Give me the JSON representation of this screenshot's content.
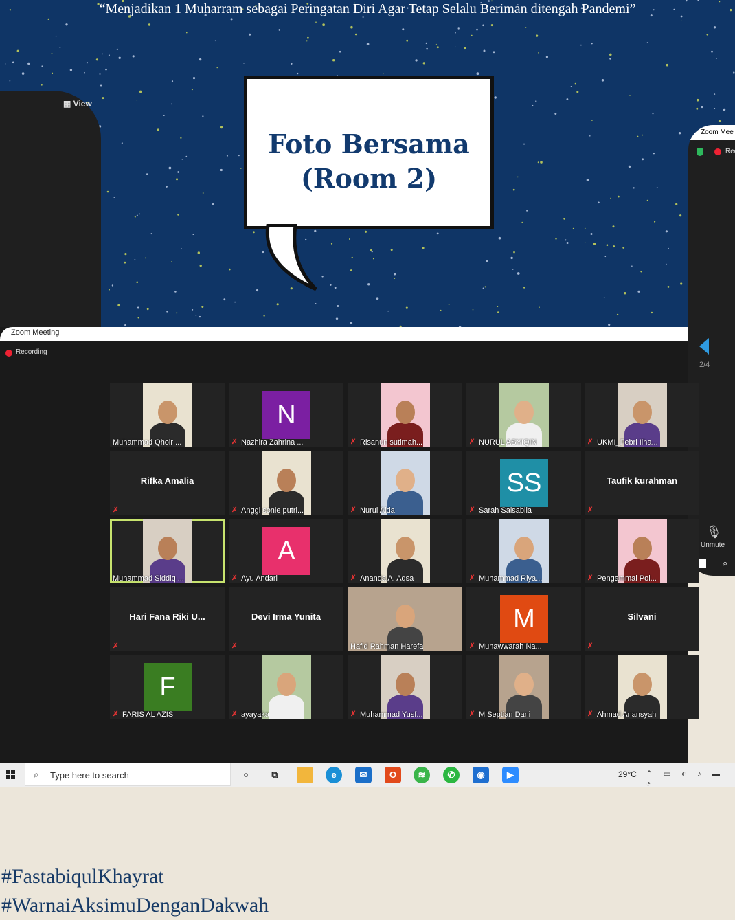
{
  "banner": {
    "title": "“Menjadikan 1 Muharram sebagai Peringatan Diri Agar Tetap Selalu Beriman ditengah Pandemi”"
  },
  "bubble": {
    "line1": "Foto Bersama",
    "line2": "(Room 2)"
  },
  "left_panel": {
    "view_label": "View"
  },
  "right_panel": {
    "title": "Zoom Mee",
    "rec_label": "Rec",
    "unmute_label": "Unmute"
  },
  "zoom": {
    "title": "Zoom Meeting",
    "recording_label": "Recording",
    "page_indicator": "2/4"
  },
  "participants": [
    {
      "name": "Muhammad Qhoir ...",
      "type": "video",
      "muted": false
    },
    {
      "name": "Nazhira Zahrina ...",
      "type": "letter",
      "letter": "N",
      "color": "#7b1fa2",
      "muted": true
    },
    {
      "name": "Risanun sutimah...",
      "type": "video",
      "muted": true
    },
    {
      "name": "NURUL ASYIQIN",
      "type": "video",
      "muted": true
    },
    {
      "name": "UKMI_Febri Ilha...",
      "type": "video",
      "muted": true
    },
    {
      "name": "Rifka Amalia",
      "type": "name",
      "muted": true
    },
    {
      "name": "Anggi sonie putri...",
      "type": "video",
      "muted": true
    },
    {
      "name": "Nurul Aida",
      "type": "video",
      "muted": true
    },
    {
      "name": "Sarah Salsabila",
      "type": "letter",
      "letter": "SS",
      "color": "#1f8fa6",
      "muted": true
    },
    {
      "name": "Taufik kurahman",
      "type": "name",
      "muted": true
    },
    {
      "name": "Muhammad Siddiq ...",
      "type": "video",
      "muted": false,
      "active": true
    },
    {
      "name": "Ayu Andari",
      "type": "letter",
      "letter": "A",
      "color": "#e8306c",
      "muted": true
    },
    {
      "name": "Ananda A. Aqsa",
      "type": "video",
      "muted": true
    },
    {
      "name": "Muhammad Riya...",
      "type": "video",
      "muted": true
    },
    {
      "name": "Pengammal Pol...",
      "type": "video",
      "muted": true
    },
    {
      "name": "Hari Fana Riki U...",
      "type": "name",
      "muted": true
    },
    {
      "name": "Devi Irma Yunita",
      "type": "name",
      "muted": true
    },
    {
      "name": "Hafid Rahman Harefa",
      "type": "video",
      "muted": false
    },
    {
      "name": "Munawwarah Na...",
      "type": "letter",
      "letter": "M",
      "color": "#e04a12",
      "muted": true
    },
    {
      "name": "Silvani",
      "type": "name",
      "muted": true
    },
    {
      "name": "FARIS AL AZIS",
      "type": "letter",
      "letter": "F",
      "color": "#3a7d22",
      "muted": true
    },
    {
      "name": "ayayaka",
      "type": "video",
      "muted": true
    },
    {
      "name": "Muhammad Yusf...",
      "type": "video",
      "muted": true
    },
    {
      "name": "M Septian Dani",
      "type": "video",
      "muted": true
    },
    {
      "name": "Ahmad Ariansyah",
      "type": "video",
      "muted": true
    }
  ],
  "taskbar": {
    "search_placeholder": "Type here to search",
    "temperature": "29°C"
  },
  "hashtags": {
    "line1": "#FastabiqulKhayrat",
    "line2": "#WarnaiAksimuDenganDakwah"
  }
}
